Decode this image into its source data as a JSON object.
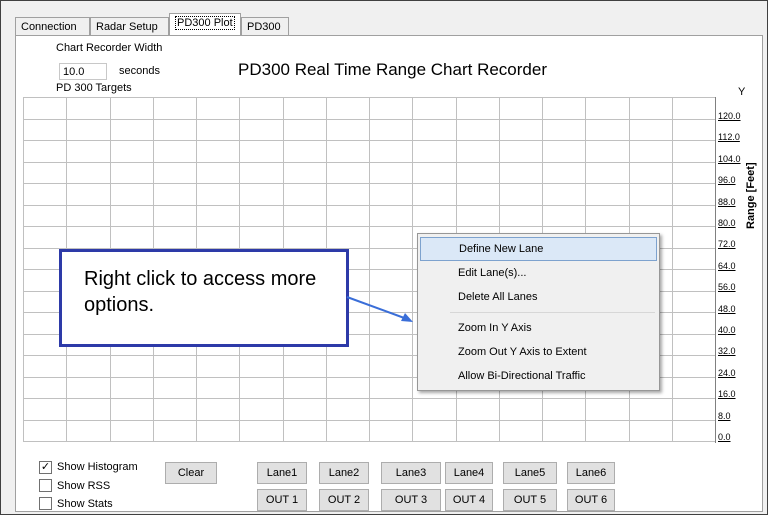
{
  "tabs": [
    {
      "label": "Connection"
    },
    {
      "label": "Radar Setup"
    },
    {
      "label": "PD300 Plot"
    },
    {
      "label": "PD300"
    }
  ],
  "settings": {
    "width_label": "Chart Recorder Width",
    "width_value": "10.0",
    "width_units": "seconds",
    "targets_label": "PD 300 Targets"
  },
  "chart": {
    "title": "PD300 Real Time Range Chart Recorder",
    "y_corner_label": "Y",
    "y_title": "Range [Feet]",
    "ticks": [
      "120.0",
      "112.0",
      "104.0",
      "96.0",
      "88.0",
      "80.0",
      "72.0",
      "64.0",
      "56.0",
      "48.0",
      "40.0",
      "32.0",
      "24.0",
      "16.0",
      "8.0",
      "0.0"
    ]
  },
  "chart_data": {
    "type": "line",
    "title": "PD300 Real Time Range Chart Recorder",
    "ylabel": "Range [Feet]",
    "ylim": [
      0,
      120
    ],
    "yticks": [
      120.0,
      112.0,
      104.0,
      96.0,
      88.0,
      80.0,
      72.0,
      64.0,
      56.0,
      48.0,
      40.0,
      32.0,
      24.0,
      16.0,
      8.0,
      0.0
    ],
    "series": []
  },
  "context_menu": {
    "items": [
      {
        "label": "Define New Lane",
        "highlighted": true
      },
      {
        "label": "Edit Lane(s)..."
      },
      {
        "label": "Delete All Lanes"
      },
      {
        "label": "Zoom In Y Axis"
      },
      {
        "label": "Zoom Out Y Axis to Extent"
      },
      {
        "label": "Allow Bi-Directional Traffic"
      }
    ]
  },
  "callout": {
    "text": "Right click to access more options."
  },
  "options": {
    "show_histogram": {
      "label": "Show Histogram",
      "checked": true
    },
    "show_rss": {
      "label": "Show RSS",
      "checked": false
    },
    "show_stats": {
      "label": "Show Stats",
      "checked": false
    },
    "clear_label": "Clear"
  },
  "lanes": [
    "Lane1",
    "Lane2",
    "Lane3",
    "Lane4",
    "Lane5",
    "Lane6"
  ],
  "outputs": [
    "OUT 1",
    "OUT 2",
    "OUT 3",
    "OUT 4",
    "OUT 5",
    "OUT 6"
  ],
  "colors": {
    "callout_border": "#2d3aa8",
    "callout_arrow": "#3a6ed8",
    "menu_highlight": "#dbe8f7"
  }
}
